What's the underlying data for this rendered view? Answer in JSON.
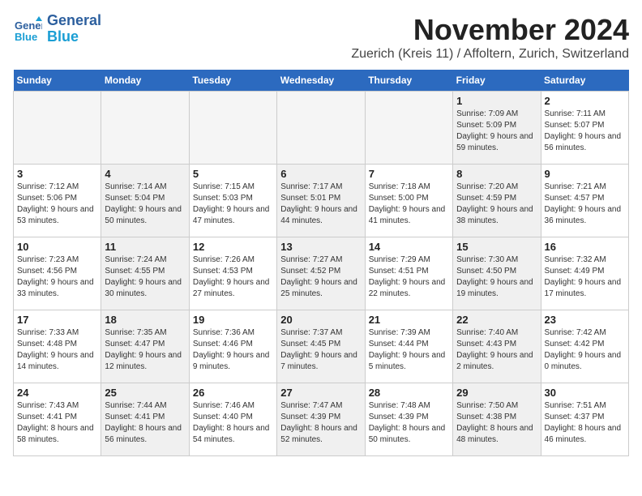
{
  "header": {
    "logo_line1": "General",
    "logo_line2": "Blue",
    "month_year": "November 2024",
    "location": "Zuerich (Kreis 11) / Affoltern, Zurich, Switzerland"
  },
  "days_of_week": [
    "Sunday",
    "Monday",
    "Tuesday",
    "Wednesday",
    "Thursday",
    "Friday",
    "Saturday"
  ],
  "weeks": [
    [
      {
        "day": "",
        "info": "",
        "empty": true
      },
      {
        "day": "",
        "info": "",
        "empty": true
      },
      {
        "day": "",
        "info": "",
        "empty": true
      },
      {
        "day": "",
        "info": "",
        "empty": true
      },
      {
        "day": "",
        "info": "",
        "empty": true
      },
      {
        "day": "1",
        "info": "Sunrise: 7:09 AM\nSunset: 5:09 PM\nDaylight: 9 hours and 59 minutes.",
        "shaded": true
      },
      {
        "day": "2",
        "info": "Sunrise: 7:11 AM\nSunset: 5:07 PM\nDaylight: 9 hours and 56 minutes.",
        "shaded": false
      }
    ],
    [
      {
        "day": "3",
        "info": "Sunrise: 7:12 AM\nSunset: 5:06 PM\nDaylight: 9 hours and 53 minutes.",
        "shaded": false
      },
      {
        "day": "4",
        "info": "Sunrise: 7:14 AM\nSunset: 5:04 PM\nDaylight: 9 hours and 50 minutes.",
        "shaded": true
      },
      {
        "day": "5",
        "info": "Sunrise: 7:15 AM\nSunset: 5:03 PM\nDaylight: 9 hours and 47 minutes.",
        "shaded": false
      },
      {
        "day": "6",
        "info": "Sunrise: 7:17 AM\nSunset: 5:01 PM\nDaylight: 9 hours and 44 minutes.",
        "shaded": true
      },
      {
        "day": "7",
        "info": "Sunrise: 7:18 AM\nSunset: 5:00 PM\nDaylight: 9 hours and 41 minutes.",
        "shaded": false
      },
      {
        "day": "8",
        "info": "Sunrise: 7:20 AM\nSunset: 4:59 PM\nDaylight: 9 hours and 38 minutes.",
        "shaded": true
      },
      {
        "day": "9",
        "info": "Sunrise: 7:21 AM\nSunset: 4:57 PM\nDaylight: 9 hours and 36 minutes.",
        "shaded": false
      }
    ],
    [
      {
        "day": "10",
        "info": "Sunrise: 7:23 AM\nSunset: 4:56 PM\nDaylight: 9 hours and 33 minutes.",
        "shaded": false
      },
      {
        "day": "11",
        "info": "Sunrise: 7:24 AM\nSunset: 4:55 PM\nDaylight: 9 hours and 30 minutes.",
        "shaded": true
      },
      {
        "day": "12",
        "info": "Sunrise: 7:26 AM\nSunset: 4:53 PM\nDaylight: 9 hours and 27 minutes.",
        "shaded": false
      },
      {
        "day": "13",
        "info": "Sunrise: 7:27 AM\nSunset: 4:52 PM\nDaylight: 9 hours and 25 minutes.",
        "shaded": true
      },
      {
        "day": "14",
        "info": "Sunrise: 7:29 AM\nSunset: 4:51 PM\nDaylight: 9 hours and 22 minutes.",
        "shaded": false
      },
      {
        "day": "15",
        "info": "Sunrise: 7:30 AM\nSunset: 4:50 PM\nDaylight: 9 hours and 19 minutes.",
        "shaded": true
      },
      {
        "day": "16",
        "info": "Sunrise: 7:32 AM\nSunset: 4:49 PM\nDaylight: 9 hours and 17 minutes.",
        "shaded": false
      }
    ],
    [
      {
        "day": "17",
        "info": "Sunrise: 7:33 AM\nSunset: 4:48 PM\nDaylight: 9 hours and 14 minutes.",
        "shaded": false
      },
      {
        "day": "18",
        "info": "Sunrise: 7:35 AM\nSunset: 4:47 PM\nDaylight: 9 hours and 12 minutes.",
        "shaded": true
      },
      {
        "day": "19",
        "info": "Sunrise: 7:36 AM\nSunset: 4:46 PM\nDaylight: 9 hours and 9 minutes.",
        "shaded": false
      },
      {
        "day": "20",
        "info": "Sunrise: 7:37 AM\nSunset: 4:45 PM\nDaylight: 9 hours and 7 minutes.",
        "shaded": true
      },
      {
        "day": "21",
        "info": "Sunrise: 7:39 AM\nSunset: 4:44 PM\nDaylight: 9 hours and 5 minutes.",
        "shaded": false
      },
      {
        "day": "22",
        "info": "Sunrise: 7:40 AM\nSunset: 4:43 PM\nDaylight: 9 hours and 2 minutes.",
        "shaded": true
      },
      {
        "day": "23",
        "info": "Sunrise: 7:42 AM\nSunset: 4:42 PM\nDaylight: 9 hours and 0 minutes.",
        "shaded": false
      }
    ],
    [
      {
        "day": "24",
        "info": "Sunrise: 7:43 AM\nSunset: 4:41 PM\nDaylight: 8 hours and 58 minutes.",
        "shaded": false
      },
      {
        "day": "25",
        "info": "Sunrise: 7:44 AM\nSunset: 4:41 PM\nDaylight: 8 hours and 56 minutes.",
        "shaded": true
      },
      {
        "day": "26",
        "info": "Sunrise: 7:46 AM\nSunset: 4:40 PM\nDaylight: 8 hours and 54 minutes.",
        "shaded": false
      },
      {
        "day": "27",
        "info": "Sunrise: 7:47 AM\nSunset: 4:39 PM\nDaylight: 8 hours and 52 minutes.",
        "shaded": true
      },
      {
        "day": "28",
        "info": "Sunrise: 7:48 AM\nSunset: 4:39 PM\nDaylight: 8 hours and 50 minutes.",
        "shaded": false
      },
      {
        "day": "29",
        "info": "Sunrise: 7:50 AM\nSunset: 4:38 PM\nDaylight: 8 hours and 48 minutes.",
        "shaded": true
      },
      {
        "day": "30",
        "info": "Sunrise: 7:51 AM\nSunset: 4:37 PM\nDaylight: 8 hours and 46 minutes.",
        "shaded": false
      }
    ]
  ]
}
